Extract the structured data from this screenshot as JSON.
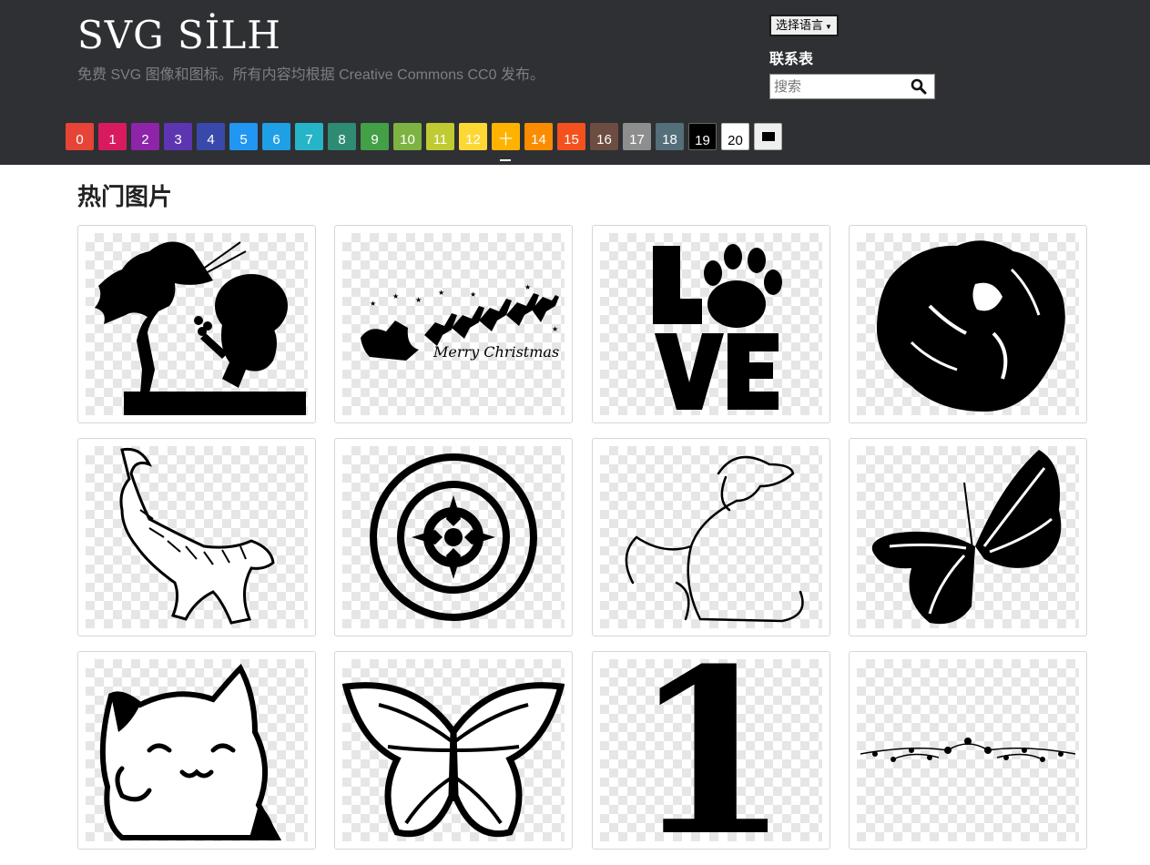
{
  "site": {
    "title": "SVG SİLH",
    "subtitle": "免费 SVG 图像和图标。所有内容均根据 Creative Commons CC0 发布。"
  },
  "header": {
    "language_button": "选择语言",
    "contact_link": "联系表",
    "search_placeholder": "搜索"
  },
  "color_filter": {
    "selected": "十",
    "swatches": [
      {
        "label": "0",
        "color": "#e64437"
      },
      {
        "label": "1",
        "color": "#d81b60"
      },
      {
        "label": "2",
        "color": "#8e24aa"
      },
      {
        "label": "3",
        "color": "#5e35b1"
      },
      {
        "label": "4",
        "color": "#3949ab"
      },
      {
        "label": "5",
        "color": "#2196f3"
      },
      {
        "label": "6",
        "color": "#1e9fe6"
      },
      {
        "label": "7",
        "color": "#26b5c8"
      },
      {
        "label": "8",
        "color": "#2e8b74"
      },
      {
        "label": "9",
        "color": "#43a047"
      },
      {
        "label": "10",
        "color": "#7cb342"
      },
      {
        "label": "11",
        "color": "#c0ca33"
      },
      {
        "label": "12",
        "color": "#fdd835"
      },
      {
        "label": "十",
        "color": "#ffb300"
      },
      {
        "label": "14",
        "color": "#fb8c00"
      },
      {
        "label": "15",
        "color": "#f4511e"
      },
      {
        "label": "16",
        "color": "#6d4c41"
      },
      {
        "label": "17",
        "color": "#8e8e8e"
      },
      {
        "label": "18",
        "color": "#546e7a"
      },
      {
        "label": "19",
        "color": "#000000"
      },
      {
        "label": "20",
        "color": "#ffffff"
      },
      {
        "label": "",
        "color": "#efefef",
        "icon": "black-rectangle-icon"
      }
    ]
  },
  "main": {
    "section_title": "热门图片",
    "images": [
      {
        "name": "couple-flowers-silhouette"
      },
      {
        "name": "santa-sleigh-merry-christmas",
        "text": "Merry Christmas"
      },
      {
        "name": "love-paw-print"
      },
      {
        "name": "rose-silhouette"
      },
      {
        "name": "tiger-leaping-sketch"
      },
      {
        "name": "mandala-flower"
      },
      {
        "name": "dog-line-art"
      },
      {
        "name": "butterfly-silhouette"
      },
      {
        "name": "lucky-cat-line-art"
      },
      {
        "name": "monarch-butterfly"
      },
      {
        "name": "number-one-serif",
        "text": "1"
      },
      {
        "name": "floral-divider"
      }
    ]
  }
}
